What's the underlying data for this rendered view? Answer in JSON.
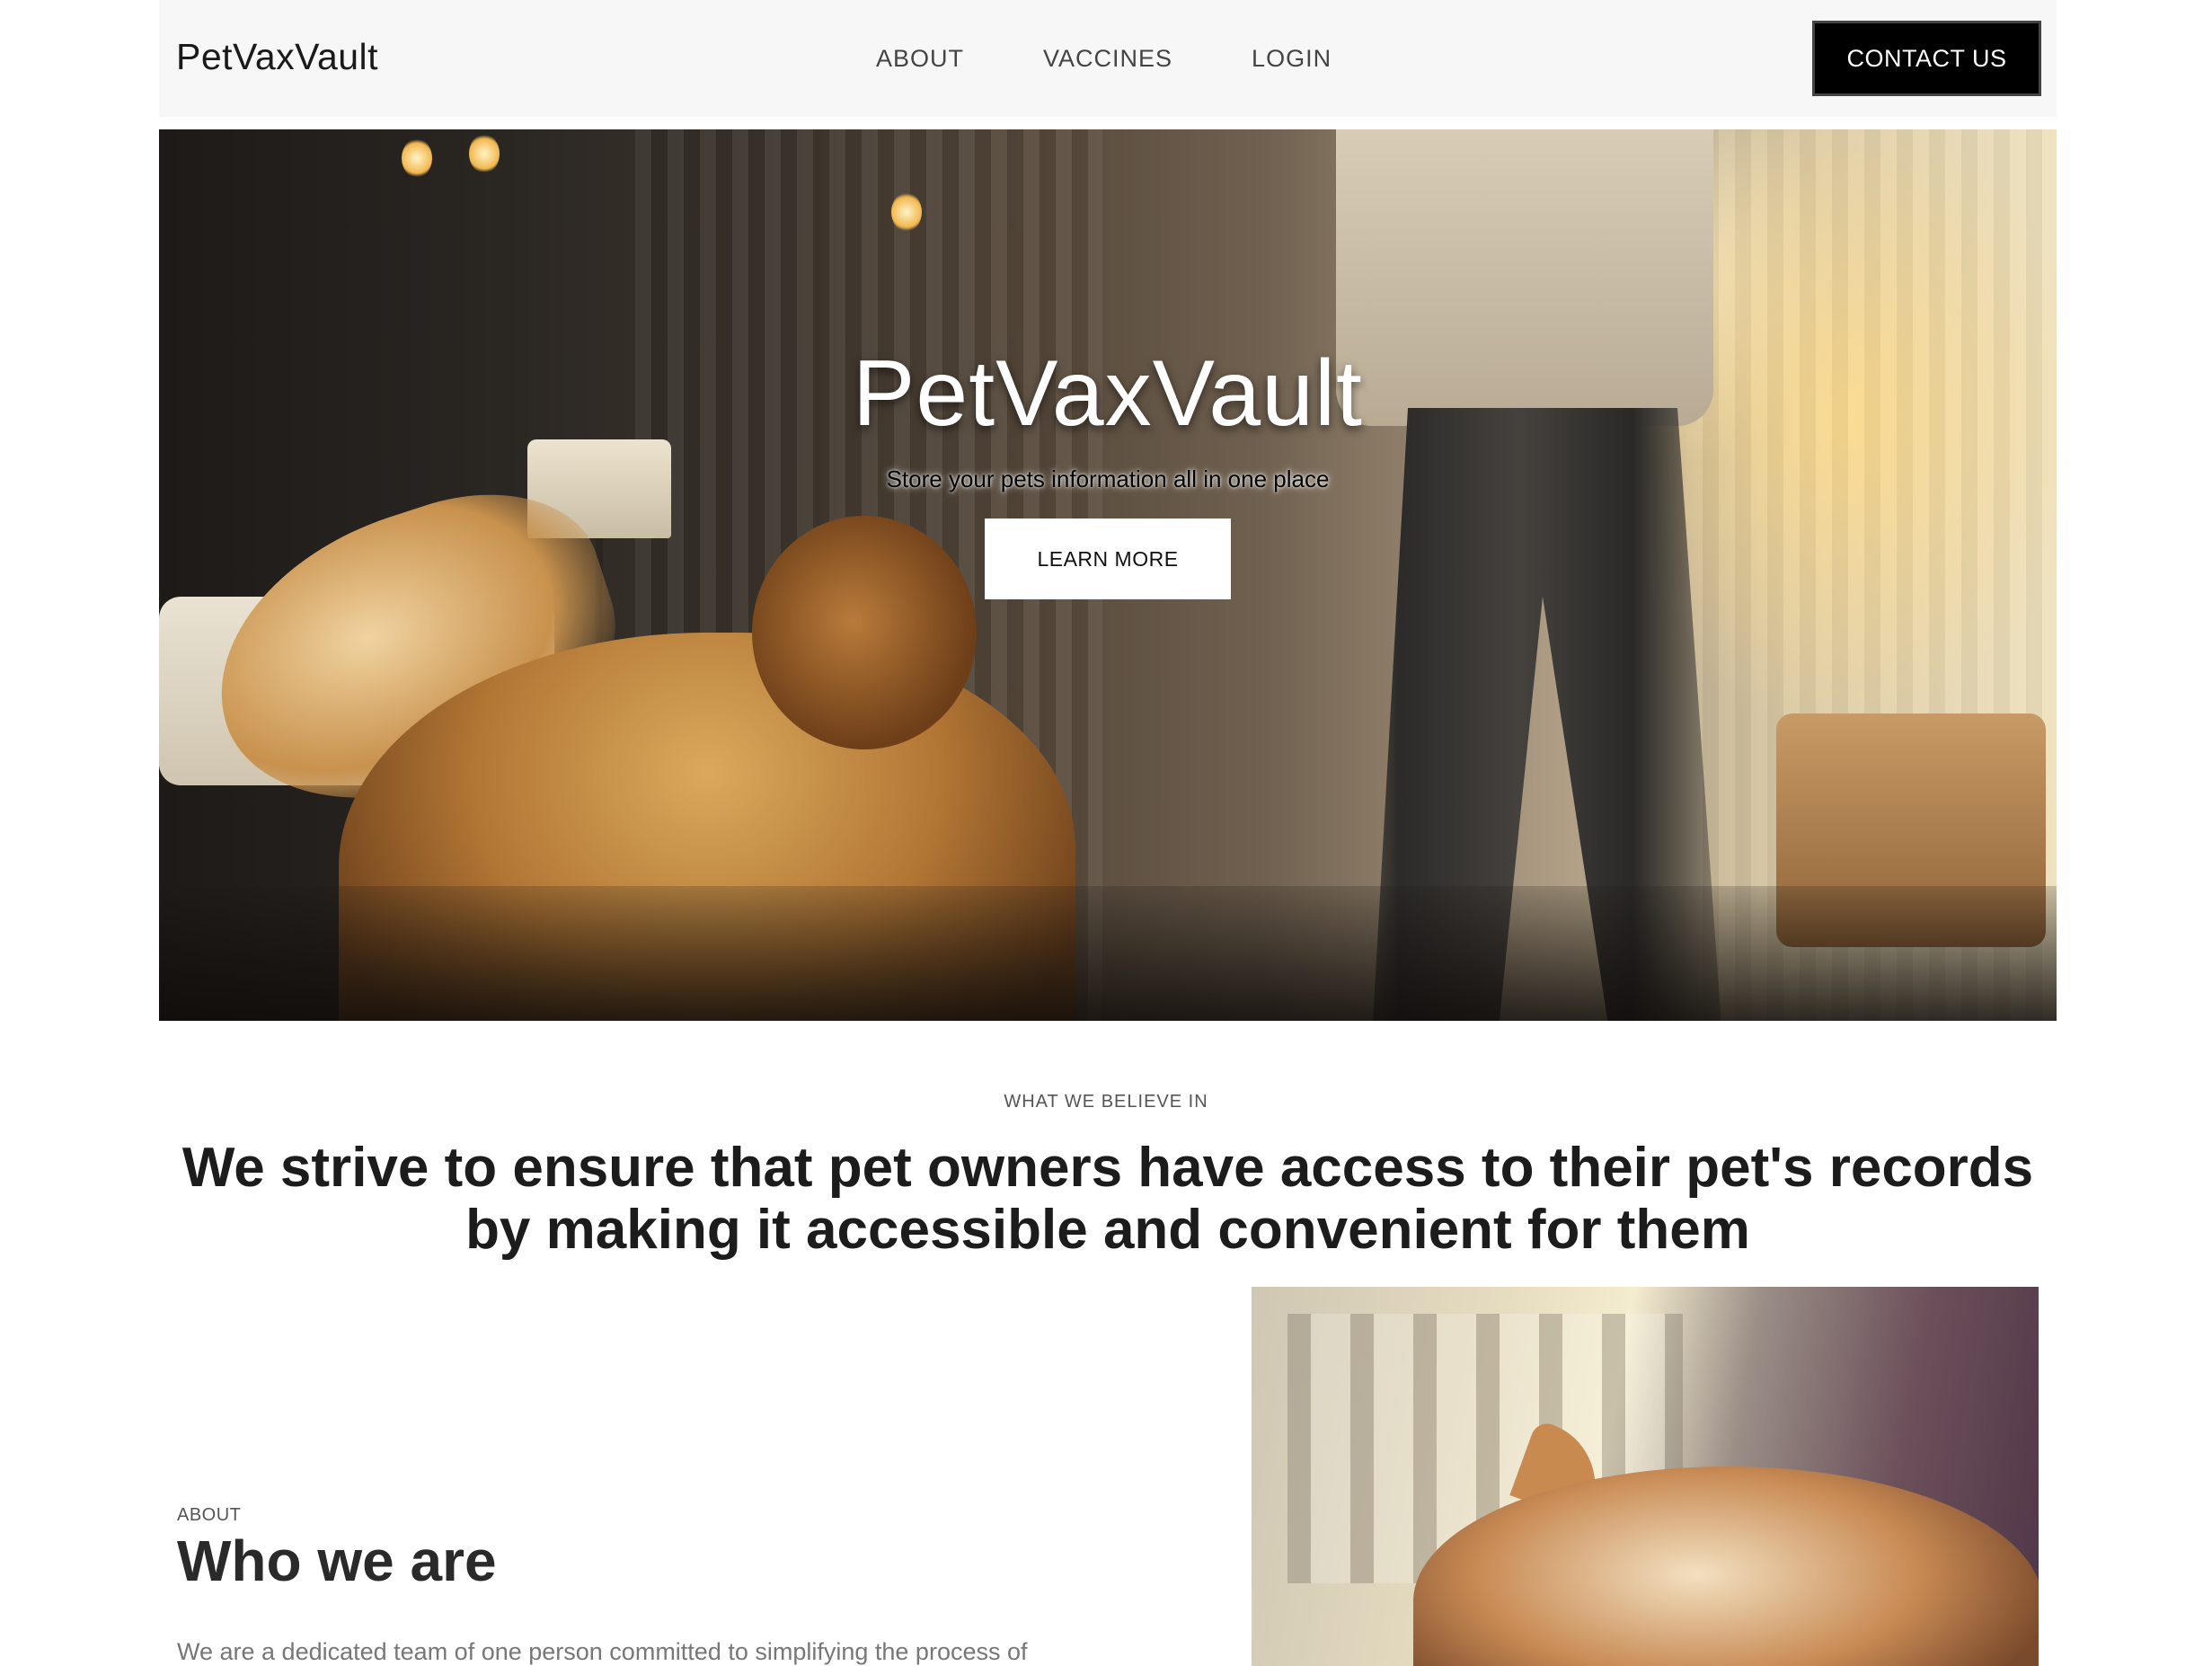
{
  "header": {
    "brand": "PetVaxVault",
    "nav": [
      {
        "label": "ABOUT"
      },
      {
        "label": "VACCINES"
      },
      {
        "label": "LOGIN"
      }
    ],
    "contact_label": "CONTACT US"
  },
  "hero": {
    "title": "PetVaxVault",
    "subtitle": "Store your pets information all in one place",
    "button_label": "LEARN MORE"
  },
  "beliefs": {
    "eyebrow": "WHAT WE BELIEVE IN",
    "headline": "We strive to ensure that pet owners have access to their pet's records by making it accessible and convenient for them"
  },
  "about": {
    "eyebrow": "ABOUT",
    "title": "Who we are",
    "text": "We are a dedicated team of one person committed to simplifying the process of"
  },
  "colors": {
    "nav_bg": "#f7f7f7",
    "contact_bg": "#000000",
    "text_dark": "#1c1c1c",
    "text_muted": "#777777"
  }
}
